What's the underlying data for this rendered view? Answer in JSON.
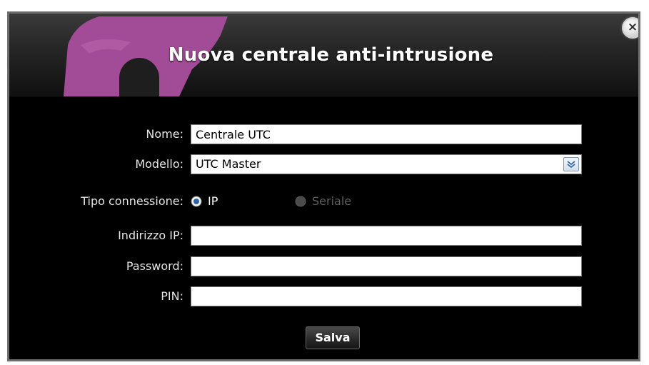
{
  "dialog": {
    "title": "Nuova centrale anti-intrusione",
    "close_label": "×"
  },
  "form": {
    "nome": {
      "label": "Nome:",
      "value": "Centrale UTC"
    },
    "modello": {
      "label": "Modello:",
      "value": "UTC Master"
    },
    "tipo_connessione": {
      "label": "Tipo connessione:",
      "options": [
        {
          "label": "IP",
          "selected": true,
          "enabled": true
        },
        {
          "label": "Seriale",
          "selected": false,
          "enabled": false
        }
      ]
    },
    "indirizzo_ip": {
      "label": "Indirizzo IP:",
      "value": ""
    },
    "password": {
      "label": "Password:",
      "value": ""
    },
    "pin": {
      "label": "PIN:",
      "value": ""
    }
  },
  "actions": {
    "save_label": "Salva"
  },
  "colors": {
    "logo_accent": "#a24b96",
    "background": "#000000",
    "label_text": "#e4e4e4",
    "disabled_text": "#5f5f5f"
  },
  "icons": {
    "close": "close-icon",
    "select_arrow": "chevron-down-icon",
    "logo": "logo-icon"
  }
}
